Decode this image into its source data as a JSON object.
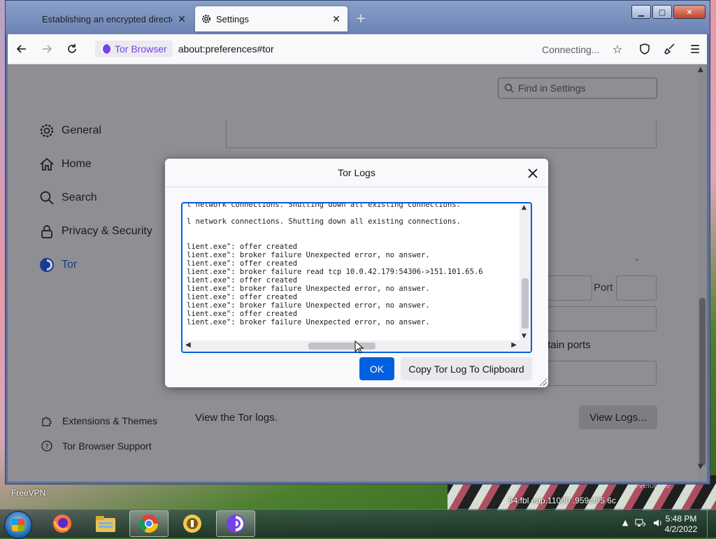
{
  "browser": {
    "tabs": [
      {
        "title": "Establishing an encrypted directory",
        "active": false
      },
      {
        "title": "Settings",
        "active": true
      }
    ],
    "identity_label": "Tor Browser",
    "url": "about:preferences#tor",
    "status": "Connecting..."
  },
  "settings": {
    "search_placeholder": "Find in Settings",
    "sidebar": [
      {
        "label": "General",
        "icon": "gear-icon"
      },
      {
        "label": "Home",
        "icon": "home-icon"
      },
      {
        "label": "Search",
        "icon": "search-icon"
      },
      {
        "label": "Privacy & Security",
        "icon": "lock-icon"
      },
      {
        "label": "Tor",
        "icon": "tor-onion-icon",
        "selected": true
      }
    ],
    "footer": [
      {
        "label": "Extensions & Themes",
        "icon": "puzzle-icon"
      },
      {
        "label": "Tor Browser Support",
        "icon": "help-icon"
      }
    ],
    "port_label": "Port",
    "ports_text": "tain ports",
    "view_logs_text": "View the Tor logs.",
    "view_logs_button": "View Logs..."
  },
  "dialog": {
    "title": "Tor Logs",
    "log_lines": [
      "l network connections. Shutting down all existing connections.",
      "",
      "l network connections. Shutting down all existing connections.",
      "",
      "",
      "lient.exe\": offer created",
      "lient.exe\": broker failure Unexpected error, no answer.",
      "lient.exe\": offer created",
      "lient.exe\": broker failure read tcp 10.0.42.179:54306->151.101.65.6",
      "lient.exe\": offer created",
      "lient.exe\": broker failure Unexpected error, no answer.",
      "lient.exe\": offer created",
      "lient.exe\": broker failure Unexpected error, no answer.",
      "lient.exe\": offer created",
      "lient.exe\": broker failure Unexpected error, no answer."
    ],
    "ok_label": "OK",
    "copy_label": "Copy Tor Log To Clipboard"
  },
  "desktop": {
    "label": "FreeVPN",
    "overlay_text": "64.fbl    eap.11080         .959cf95        6c",
    "overlay_text2": "Develop   ne"
  },
  "taskbar": {
    "apps": [
      "firefox-icon",
      "file-explorer-icon",
      "chrome-icon",
      "tor-launcher-icon",
      "tor-browser-icon"
    ],
    "time": "5:48 PM",
    "date": "4/2/2022"
  },
  "colors": {
    "accent": "#0060df",
    "tor_purple": "#7542e5"
  }
}
